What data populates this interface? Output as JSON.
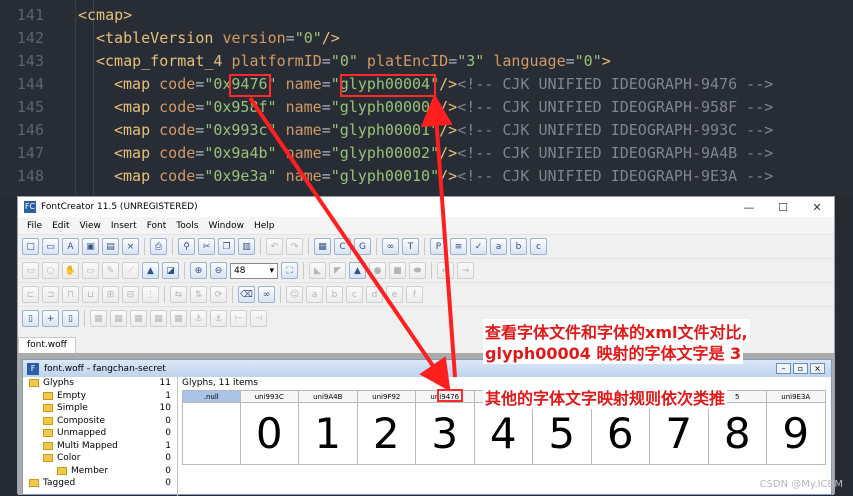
{
  "editor": {
    "lines": [
      {
        "num": "141",
        "parts": [
          [
            "tag",
            "<cmap>"
          ]
        ]
      },
      {
        "num": "142",
        "parts": [
          [
            "tag",
            "<tableVersion "
          ],
          [
            "attr",
            "version"
          ],
          [
            "plain",
            "="
          ],
          [
            "val",
            "\"0\""
          ],
          [
            "tag",
            "/>"
          ]
        ]
      },
      {
        "num": "143",
        "parts": [
          [
            "tag",
            "<cmap_format_4 "
          ],
          [
            "attr",
            "platformID"
          ],
          [
            "plain",
            "="
          ],
          [
            "val",
            "\"0\""
          ],
          [
            "attr",
            " platEncID"
          ],
          [
            "plain",
            "="
          ],
          [
            "val",
            "\"3\""
          ],
          [
            "attr",
            " language"
          ],
          [
            "plain",
            "="
          ],
          [
            "val",
            "\"0\""
          ],
          [
            "tag",
            ">"
          ]
        ]
      },
      {
        "num": "144",
        "parts": [
          [
            "tag",
            "<map "
          ],
          [
            "attr",
            "code"
          ],
          [
            "plain",
            "="
          ],
          [
            "val",
            "\"0x9476\""
          ],
          [
            "attr",
            " name"
          ],
          [
            "plain",
            "="
          ],
          [
            "val",
            "\"glyph00004\""
          ],
          [
            "tag",
            "/>"
          ],
          [
            "comment",
            "<!-- CJK UNIFIED IDEOGRAPH-9476 -->"
          ]
        ]
      },
      {
        "num": "145",
        "parts": [
          [
            "tag",
            "<map "
          ],
          [
            "attr",
            "code"
          ],
          [
            "plain",
            "="
          ],
          [
            "val",
            "\"0x958f\""
          ],
          [
            "attr",
            " name"
          ],
          [
            "plain",
            "="
          ],
          [
            "val",
            "\"glyph00000\""
          ],
          [
            "tag",
            "/>"
          ],
          [
            "comment",
            "<!-- CJK UNIFIED IDEOGRAPH-958F -->"
          ]
        ]
      },
      {
        "num": "146",
        "parts": [
          [
            "tag",
            "<map "
          ],
          [
            "attr",
            "code"
          ],
          [
            "plain",
            "="
          ],
          [
            "val",
            "\"0x993c\""
          ],
          [
            "attr",
            " name"
          ],
          [
            "plain",
            "="
          ],
          [
            "val",
            "\"glyph00001\""
          ],
          [
            "tag",
            "/>"
          ],
          [
            "comment",
            "<!-- CJK UNIFIED IDEOGRAPH-993C -->"
          ]
        ]
      },
      {
        "num": "147",
        "parts": [
          [
            "tag",
            "<map "
          ],
          [
            "attr",
            "code"
          ],
          [
            "plain",
            "="
          ],
          [
            "val",
            "\"0x9a4b\""
          ],
          [
            "attr",
            " name"
          ],
          [
            "plain",
            "="
          ],
          [
            "val",
            "\"glyph00002\""
          ],
          [
            "tag",
            "/>"
          ],
          [
            "comment",
            "<!-- CJK UNIFIED IDEOGRAPH-9A4B -->"
          ]
        ]
      },
      {
        "num": "148",
        "parts": [
          [
            "tag",
            "<map "
          ],
          [
            "attr",
            "code"
          ],
          [
            "plain",
            "="
          ],
          [
            "val",
            "\"0x9e3a\""
          ],
          [
            "attr",
            " name"
          ],
          [
            "plain",
            "="
          ],
          [
            "val",
            "\"glyph00010\""
          ],
          [
            "tag",
            "/>"
          ],
          [
            "comment",
            "<!-- CJK UNIFIED IDEOGRAPH-9E3A -->"
          ]
        ]
      }
    ]
  },
  "app": {
    "title": "FontCreator 11.5 (UNREGISTERED)",
    "icon": "FC",
    "menu": [
      "File",
      "Edit",
      "View",
      "Insert",
      "Font",
      "Tools",
      "Window",
      "Help"
    ],
    "zoom": "48",
    "doc_tab": "font.woff",
    "inner_title": "font.woff - fangchan-secret",
    "tree": [
      {
        "label": "Glyphs",
        "count": "11",
        "level": 0
      },
      {
        "label": "Empty",
        "count": "1",
        "level": 1
      },
      {
        "label": "Simple",
        "count": "10",
        "level": 1
      },
      {
        "label": "Composite",
        "count": "0",
        "level": 1
      },
      {
        "label": "Unmapped",
        "count": "0",
        "level": 1
      },
      {
        "label": "Multi Mapped",
        "count": "1",
        "level": 1
      },
      {
        "label": "Color",
        "count": "0",
        "level": 1
      },
      {
        "label": "Member",
        "count": "0",
        "level": 2
      },
      {
        "label": "Tagged",
        "count": "0",
        "level": 0
      }
    ],
    "glyph_header": "Glyphs, 11 items",
    "glyphs": [
      {
        "name": ".null",
        "glyph": ""
      },
      {
        "name": "uni993C",
        "glyph": "0"
      },
      {
        "name": "uni9A4B",
        "glyph": "1"
      },
      {
        "name": "uni9F92",
        "glyph": "2"
      },
      {
        "name": "uni9476",
        "glyph": "3"
      },
      {
        "name": "",
        "glyph": "4"
      },
      {
        "name": "",
        "glyph": "5"
      },
      {
        "name": "",
        "glyph": "6"
      },
      {
        "name": "",
        "glyph": "7"
      },
      {
        "name": "5",
        "glyph": "8"
      },
      {
        "name": "uni9E3A",
        "glyph": "9"
      }
    ]
  },
  "annotations": {
    "note1": "查看字体文件和字体的xml文件对比,",
    "note2": "glyph00004 映射的字体文字是 3",
    "note3": "其他的字体文字映射规则依次类推"
  },
  "watermark": "CSDN @My.ICBM"
}
